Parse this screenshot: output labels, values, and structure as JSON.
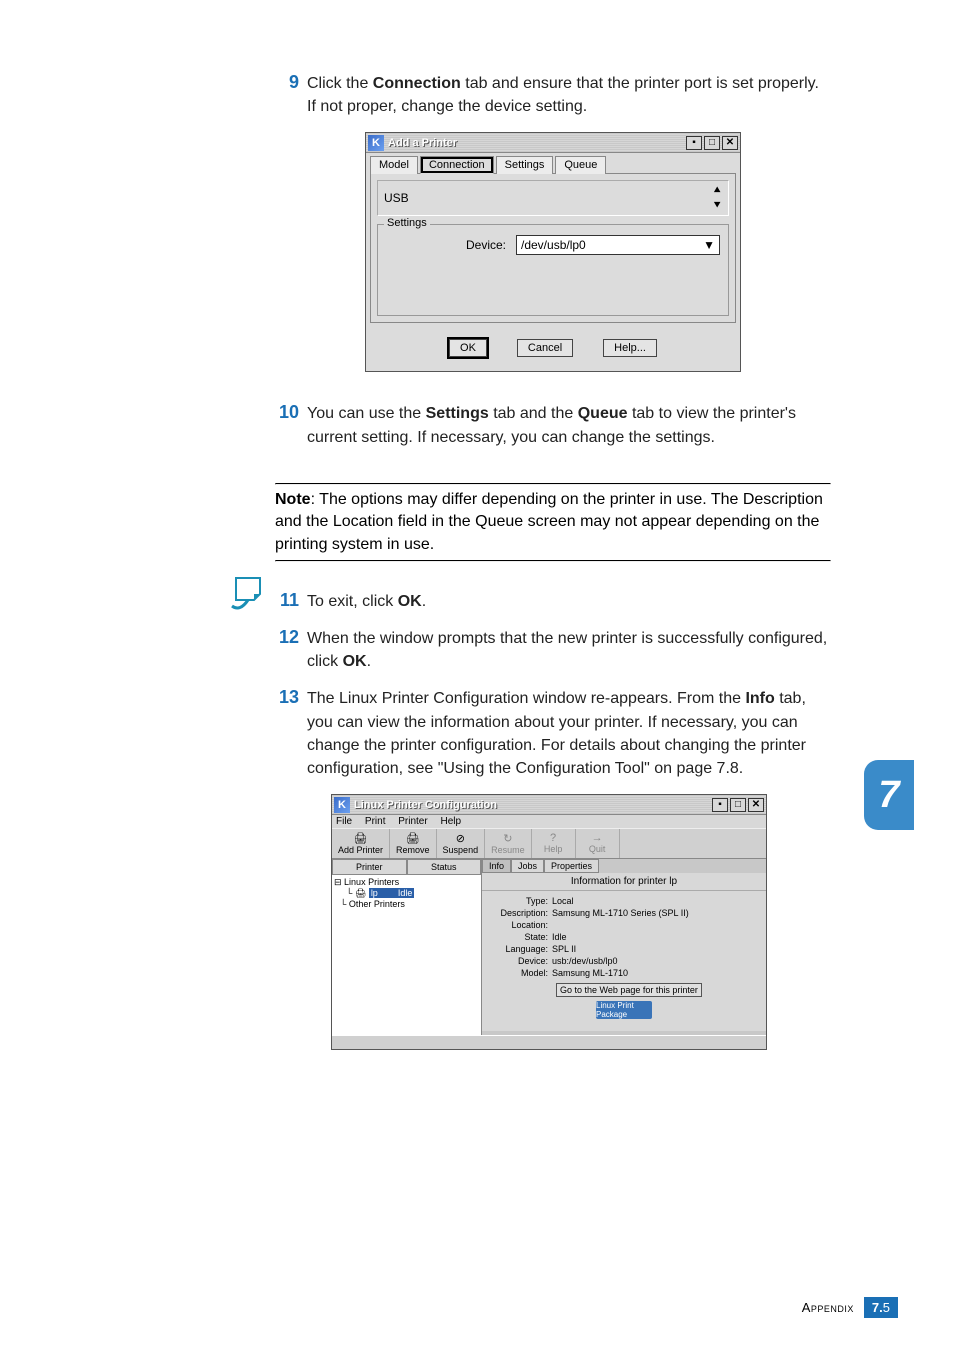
{
  "steps": {
    "s9": {
      "num": "9",
      "text_a": "Click the ",
      "bold_a": "Connection",
      "text_b": " tab and ensure that the printer port is set properly. If not proper, change the device setting."
    },
    "s10": {
      "num": "10",
      "text_a": "You can use the ",
      "bold_a": "Settings",
      "text_b": " tab and the ",
      "bold_b": "Queue",
      "text_c": " tab to view the printer's current setting. If necessary, you can change the settings."
    },
    "s11": {
      "num": "11",
      "text_a": "To exit, click ",
      "bold_a": "OK",
      "text_b": "."
    },
    "s12": {
      "num": "12",
      "text_a": "When the window prompts that the new printer is successfully configured, click ",
      "bold_a": "OK",
      "text_b": "."
    },
    "s13": {
      "num": "13",
      "text_a": "The Linux Printer Configuration window re-appears. From the ",
      "bold_a": "Info",
      "text_b": " tab, you can view the information about your printer. If necessary, you can change the printer configuration. For details about changing the printer configuration, see \"Using the Configuration Tool\" on page 7.8."
    }
  },
  "note": {
    "label": "Note",
    "body": ": The options may differ depending on the printer in use. The Description and the Location field in the Queue screen may not appear depending on the printing system in use."
  },
  "dialog1": {
    "k": "K",
    "title": "Add a Printer",
    "win": {
      "min": "▪",
      "max": "□",
      "close": "✕"
    },
    "tabs": {
      "model": "Model",
      "connection": "Connection",
      "settings": "Settings",
      "queue": "Queue"
    },
    "port_selector": "USB",
    "port_arrows": "◢◤",
    "fieldset": "Settings",
    "device_label": "Device:",
    "device_value": "/dev/usb/lp0",
    "device_arrow": "▼",
    "buttons": {
      "ok": "OK",
      "cancel": "Cancel",
      "help": "Help..."
    }
  },
  "dialog2": {
    "k": "K",
    "title": "Linux Printer Configuration",
    "win": {
      "min": "▪",
      "max": "□",
      "close": "✕"
    },
    "menu": {
      "file": "File",
      "print": "Print",
      "printer": "Printer",
      "help": "Help"
    },
    "toolbar": {
      "add": "Add Printer",
      "remove": "Remove",
      "suspend": "Suspend",
      "resume": "Resume",
      "help": "Help",
      "quit": "Quit"
    },
    "left_tabs": {
      "printer": "Printer",
      "status": "Status"
    },
    "tree": {
      "root": "Linux Printers",
      "sel_name": "lp",
      "sel_status": "Idle",
      "other": "Other Printers"
    },
    "right_tabs": {
      "info": "Info",
      "jobs": "Jobs",
      "properties": "Properties"
    },
    "info_header": "Information for printer lp",
    "info": {
      "type_l": "Type:",
      "type_v": "Local",
      "desc_l": "Description:",
      "desc_v": "Samsung ML-1710 Series (SPL II)",
      "loc_l": "Location:",
      "loc_v": "",
      "state_l": "State:",
      "state_v": "Idle",
      "lang_l": "Language:",
      "lang_v": "SPL II",
      "dev_l": "Device:",
      "dev_v": "usb:/dev/usb/lp0",
      "model_l": "Model:",
      "model_v": "Samsung ML-1710"
    },
    "go_btn": "Go to the Web page for this printer",
    "pkg": "Linux Print Package"
  },
  "chapter": "7",
  "footer": {
    "label": "Appendix",
    "chapter": "7.",
    "page": "5"
  }
}
